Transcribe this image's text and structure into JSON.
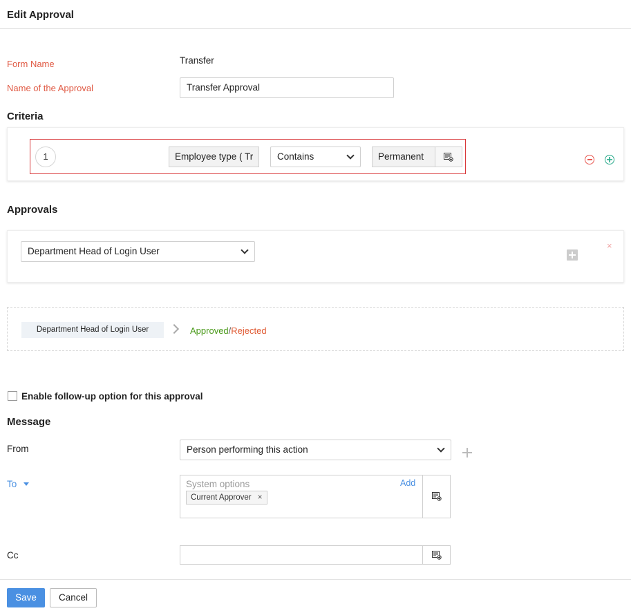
{
  "header": {
    "title": "Edit Approval"
  },
  "form": {
    "form_name_label": "Form Name",
    "form_name_value": "Transfer",
    "approval_name_label": "Name of the Approval",
    "approval_name_value": "Transfer Approval"
  },
  "criteria": {
    "title": "Criteria",
    "row": {
      "number": "1",
      "field": "Employee type ( Tr",
      "operator": "Contains",
      "value": "Permanent"
    }
  },
  "approvals": {
    "title": "Approvals",
    "approver_select": "Department Head of Login User",
    "flow_chip": "Department Head of Login User",
    "approved_label": "Approved",
    "separator": "/",
    "rejected_label": "Rejected",
    "remove_glyph": "×"
  },
  "followup": {
    "label": "Enable follow-up option for this approval"
  },
  "message": {
    "title": "Message",
    "from_label": "From",
    "from_value": "Person performing this action",
    "to_label": "To",
    "to_placeholder": "System options",
    "to_add_link": "Add",
    "to_tag": "Current Approver",
    "to_tag_remove": "×",
    "cc_label": "Cc"
  },
  "footer": {
    "save_label": "Save",
    "cancel_label": "Cancel"
  },
  "colors": {
    "red_label": "#e05a44",
    "link_blue": "#4a90e2",
    "approved_green": "#4a9a1a",
    "rejected_red": "#e05a33",
    "remove_red": "#e8554e",
    "add_green": "#26a889"
  },
  "icons": [
    "minus-circle-icon",
    "plus-circle-icon",
    "plus-icon",
    "close-icon",
    "chevron-down-icon",
    "chevron-right-icon",
    "field-picker-icon",
    "caret-down-icon"
  ]
}
